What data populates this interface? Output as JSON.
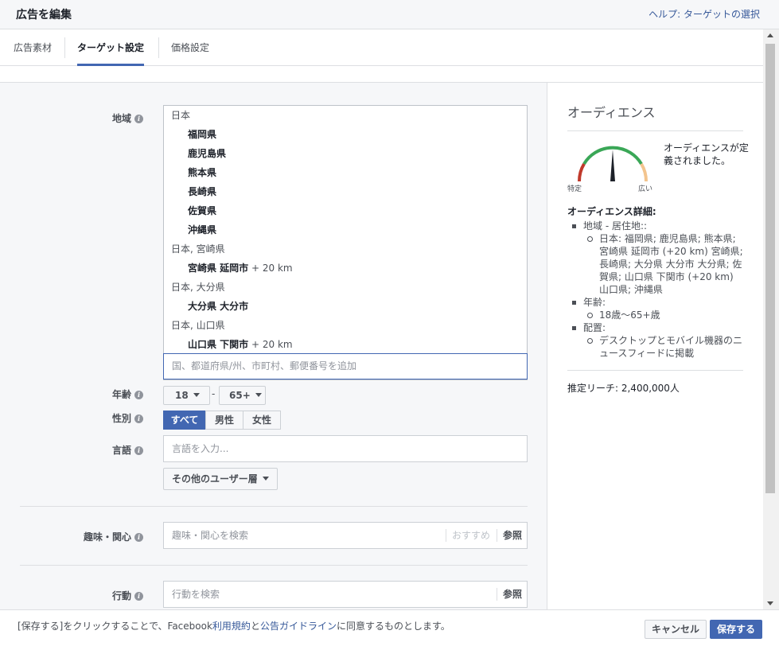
{
  "header": {
    "title": "広告を編集",
    "help_link": "ヘルプ: ターゲットの選択"
  },
  "tabs": [
    {
      "label": "広告素材"
    },
    {
      "label": "ターゲット設定"
    },
    {
      "label": "価格設定"
    }
  ],
  "form": {
    "location": {
      "label": "地域",
      "rows": [
        {
          "name": "日本",
          "sub": false
        },
        {
          "name": "福岡県",
          "sub": true
        },
        {
          "name": "鹿児島県",
          "sub": true
        },
        {
          "name": "熊本県",
          "sub": true
        },
        {
          "name": "長崎県",
          "sub": true
        },
        {
          "name": "佐賀県",
          "sub": true
        },
        {
          "name": "沖縄県",
          "sub": true
        },
        {
          "name": "日本, 宮崎県",
          "sub": false
        },
        {
          "name": "宮崎県 延岡市",
          "sub": true,
          "radius": " + 20 km"
        },
        {
          "name": "日本, 大分県",
          "sub": false
        },
        {
          "name": "大分県 大分市",
          "sub": true
        },
        {
          "name": "日本, 山口県",
          "sub": false
        },
        {
          "name": "山口県 下関市",
          "sub": true,
          "radius": " + 20 km"
        }
      ],
      "input_placeholder": "国、都道府県/州、市町村、郵便番号を追加"
    },
    "age": {
      "label": "年齢",
      "min": "18",
      "dash": "-",
      "max": "65+"
    },
    "gender": {
      "label": "性別",
      "options": [
        "すべて",
        "男性",
        "女性"
      ],
      "selected": "すべて"
    },
    "language": {
      "label": "言語",
      "placeholder": "言語を入力..."
    },
    "more_demographics": "その他のユーザー層",
    "interests": {
      "label": "趣味・関心",
      "placeholder": "趣味・関心を検索",
      "suggest": "おすすめ",
      "browse": "参照"
    },
    "behaviors": {
      "label": "行動",
      "placeholder": "行動を検索",
      "browse": "参照"
    }
  },
  "audience": {
    "title": "オーディエンス",
    "gauge_text": "オーディエンスが定義されました。",
    "gauge_left": "特定",
    "gauge_right": "広い",
    "details_title": "オーディエンス詳細:",
    "details": [
      {
        "head": "地域 - 居住地::",
        "items": [
          "日本: 福岡県; 鹿児島県; 熊本県; 宮崎県 延岡市 (+20 km) 宮崎県; 長崎県; 大分県 大分市 大分県; 佐賀県; 山口県 下関市 (+20 km) 山口県; 沖縄県"
        ]
      },
      {
        "head": "年齢:",
        "items": [
          "18歳～65+歳"
        ]
      },
      {
        "head": "配置:",
        "items": [
          "デスクトップとモバイル機器のニュースフィードに掲載"
        ]
      }
    ],
    "reach": "推定リーチ: 2,400,000人"
  },
  "footer": {
    "note_pre": "[保存する]をクリックすることで、Facebook",
    "terms_link": "利用規約",
    "note_and": "と",
    "ad_guide_link": "公告ガイドライン",
    "note_post": "に同意するものとします。",
    "cancel": "キャンセル",
    "save": "保存する"
  },
  "colors": {
    "accent": "#4267b2",
    "link": "#365899",
    "gauge_red": "#c0392b",
    "gauge_green": "#3aa757",
    "gauge_peach": "#f3c48e"
  }
}
